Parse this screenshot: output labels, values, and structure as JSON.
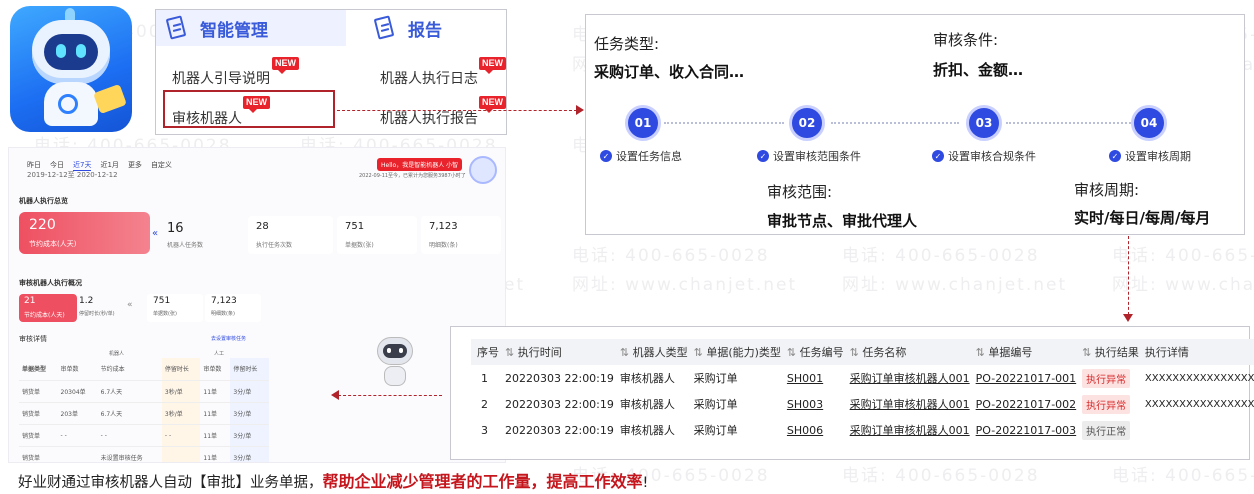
{
  "watermark": {
    "phone": "电话: 400-665-0028",
    "site": "网址: www.chanjet.net"
  },
  "menu": {
    "group1_title": "智能管理",
    "group2_title": "报告",
    "new_badge": "NEW",
    "items": {
      "guide": "机器人引导说明",
      "audit_robot": "审核机器人",
      "exec_log": "机器人执行日志",
      "exec_report": "机器人执行报告"
    }
  },
  "config": {
    "task_type_label": "任务类型:",
    "task_type_value": "采购订单、收入合同…",
    "condition_label": "审核条件:",
    "condition_value": "折扣、金额…",
    "scope_label": "审核范围:",
    "scope_value": "审批节点、审批代理人",
    "period_label": "审核周期:",
    "period_value": "实时/每日/每周/每月",
    "steps": [
      {
        "num": "01",
        "label": "设置任务信息"
      },
      {
        "num": "02",
        "label": "设置审核范围条件"
      },
      {
        "num": "03",
        "label": "设置审核合规条件"
      },
      {
        "num": "04",
        "label": "设置审核周期"
      }
    ]
  },
  "dashboard": {
    "tabs": [
      "昨日",
      "今日",
      "近7天",
      "近1月",
      "更多",
      "自定义"
    ],
    "active_tab": "近7天",
    "range": "2019-12-12至 2020-12-12",
    "hello": "Hello，我是智能机器人 小智",
    "hello_sub": "2022-09-11至今，已累计为您服务3987小时了",
    "overview_title": "机器人执行总览",
    "saved_value": "220",
    "saved_label": "节约成本(人天)",
    "stats": [
      {
        "value": "16",
        "label": "机器人任务数"
      },
      {
        "value": "28",
        "label": "执行任务次数"
      },
      {
        "value": "751",
        "label": "单据数(张)"
      },
      {
        "value": "7,123",
        "label": "明细数(条)"
      }
    ],
    "audit_title": "审核机器人执行概况",
    "audit_saved_value": "21",
    "audit_saved_label": "节约成本(人天)",
    "audit_stats": [
      {
        "value": "1.2",
        "label": "停留时长(秒/单)"
      },
      {
        "value": "751",
        "label": "单据数(张)"
      },
      {
        "value": "7,123",
        "label": "明细数(条)"
      }
    ],
    "detail_title": "审核详情",
    "detail_link": "去设置审核任务",
    "mini_headers": [
      "单据类型",
      "审单数",
      "节约成本",
      "停留时长",
      "审单数",
      "停留时长"
    ],
    "mini_group_robot": "机器人",
    "mini_group_human": "人工",
    "mini_rows": [
      [
        "销货单",
        "20304单",
        "6.7人天",
        "3秒/单",
        "11单",
        "3分/单"
      ],
      [
        "销货单",
        "203单",
        "6.7人天",
        "3秒/单",
        "11单",
        "3分/单"
      ],
      [
        "销货单",
        "- -",
        "- -",
        "- -",
        "11单",
        "3分/单"
      ],
      [
        "销货单",
        "",
        "未设置审核任务",
        "",
        "11单",
        "3分/单"
      ]
    ]
  },
  "table": {
    "headers": [
      "序号",
      "执行时间",
      "机器人类型",
      "单据(能力)类型",
      "任务编号",
      "任务名称",
      "单据编号",
      "执行结果",
      "执行详情",
      "操作"
    ],
    "rows": [
      {
        "no": "1",
        "time": "20220303 22:00:19",
        "robot": "审核机器人",
        "doc_type": "采购订单",
        "task_no": "SH001",
        "task_name": "采购订单审核机器人001",
        "doc_no": "PO-20221017-001",
        "result": "执行异常",
        "result_kind": "err",
        "detail": "XXXXXXXXXXXXXXXXXXX..."
      },
      {
        "no": "2",
        "time": "20220303 22:00:19",
        "robot": "审核机器人",
        "doc_type": "采购订单",
        "task_no": "SH003",
        "task_name": "采购订单审核机器人001",
        "doc_no": "PO-20221017-002",
        "result": "执行异常",
        "result_kind": "err",
        "detail": "XXXXXXXXXXXXXXXXXXX..."
      },
      {
        "no": "3",
        "time": "20220303 22:00:19",
        "robot": "审核机器人",
        "doc_type": "采购订单",
        "task_no": "SH006",
        "task_name": "采购订单审核机器人001",
        "doc_no": "PO-20221017-003",
        "result": "执行正常",
        "result_kind": "ok",
        "detail": ""
      }
    ]
  },
  "caption": {
    "prefix": "好业财通过审核机器人自动【审批】业务单据，",
    "emphasis": "帮助企业减少管理者的工作量，提高工作效率",
    "suffix": "!"
  },
  "colors": {
    "accent": "#2f4ae0",
    "highlight": "#b1232a",
    "badge_red": "#e8232b",
    "emphasis": "#c4161c"
  }
}
